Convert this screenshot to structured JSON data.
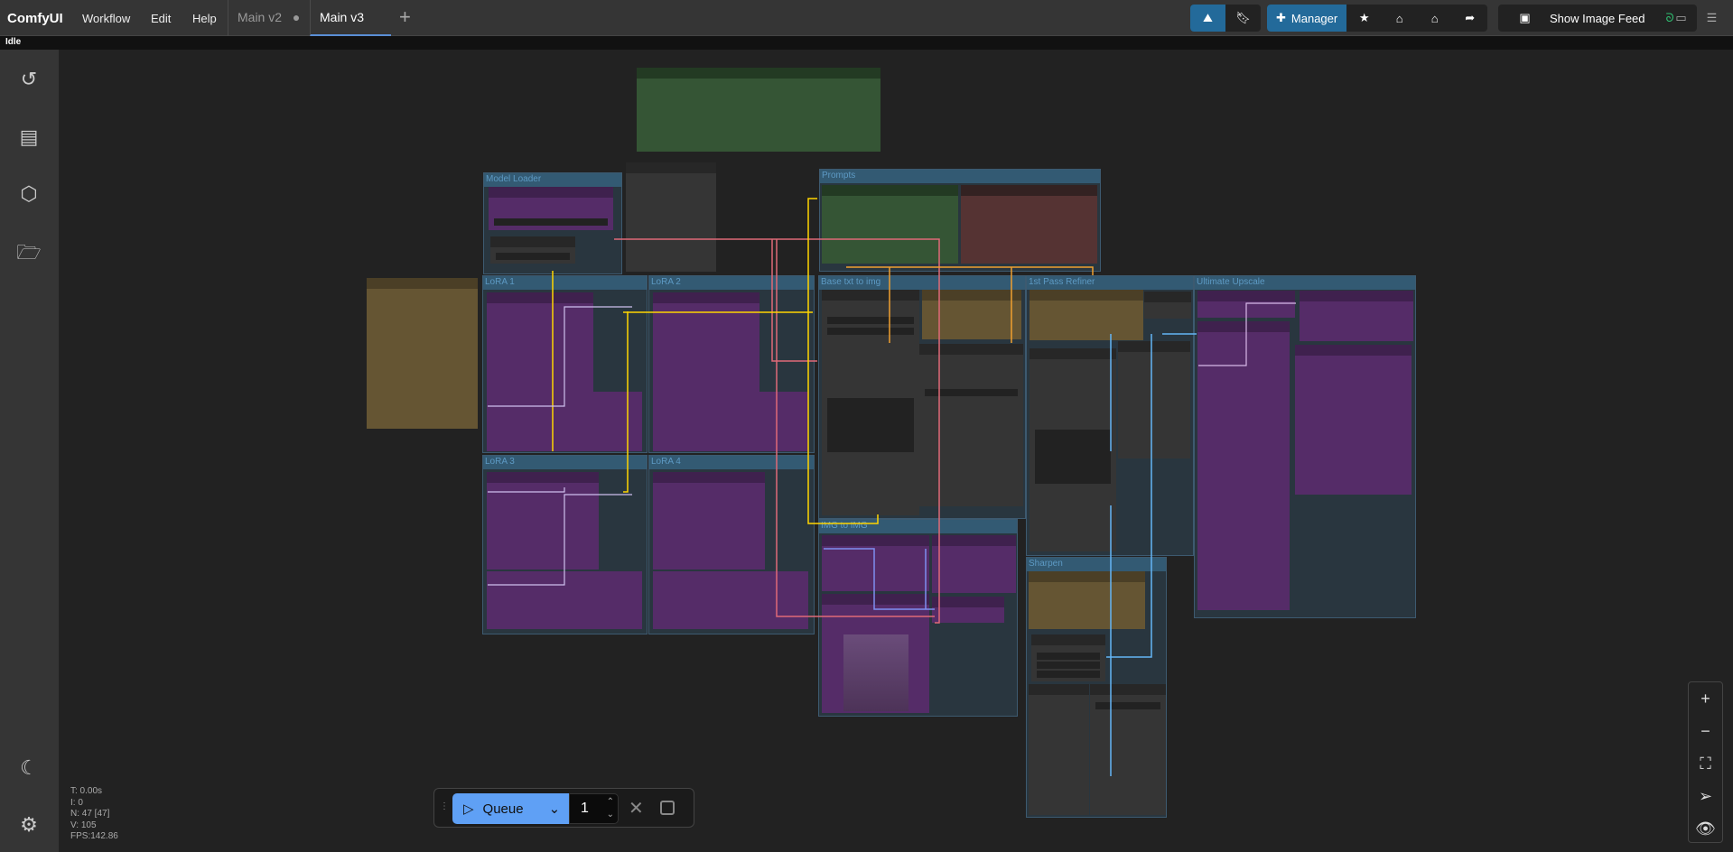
{
  "app": {
    "brand": "ComfyUI",
    "menu": [
      "Workflow",
      "Edit",
      "Help"
    ],
    "tabs": [
      {
        "label": "Main v2",
        "modified": true
      },
      {
        "label": "Main v3",
        "active": true
      }
    ]
  },
  "toolbar": {
    "manager_label": "Manager",
    "image_feed_label": "Show Image Feed"
  },
  "status": "Idle",
  "groups": {
    "model_loader": "Model Loader",
    "prompts": "Prompts",
    "lora1": "LoRA 1",
    "lora2": "LoRA 2",
    "lora3": "LoRA 3",
    "lora4": "LoRA 4",
    "base": "Base txt to img",
    "refiner": "1st Pass Refiner",
    "upscale": "Ultimate Upscale",
    "img2img": "IMG to IMG",
    "sharpen": "Sharpen"
  },
  "stats": {
    "t": "T: 0.00s",
    "i": "I: 0",
    "n": "N: 47 [47]",
    "v": "V: 105",
    "fps": "FPS:142.86"
  },
  "queue": {
    "label": "Queue",
    "count": "1"
  },
  "colors": {
    "accent": "#5fa0f5",
    "group": "#335a73",
    "clip": "#ffd500",
    "model": "#b39ddb",
    "vae": "#ff6e6e",
    "image": "#64b5f6"
  }
}
